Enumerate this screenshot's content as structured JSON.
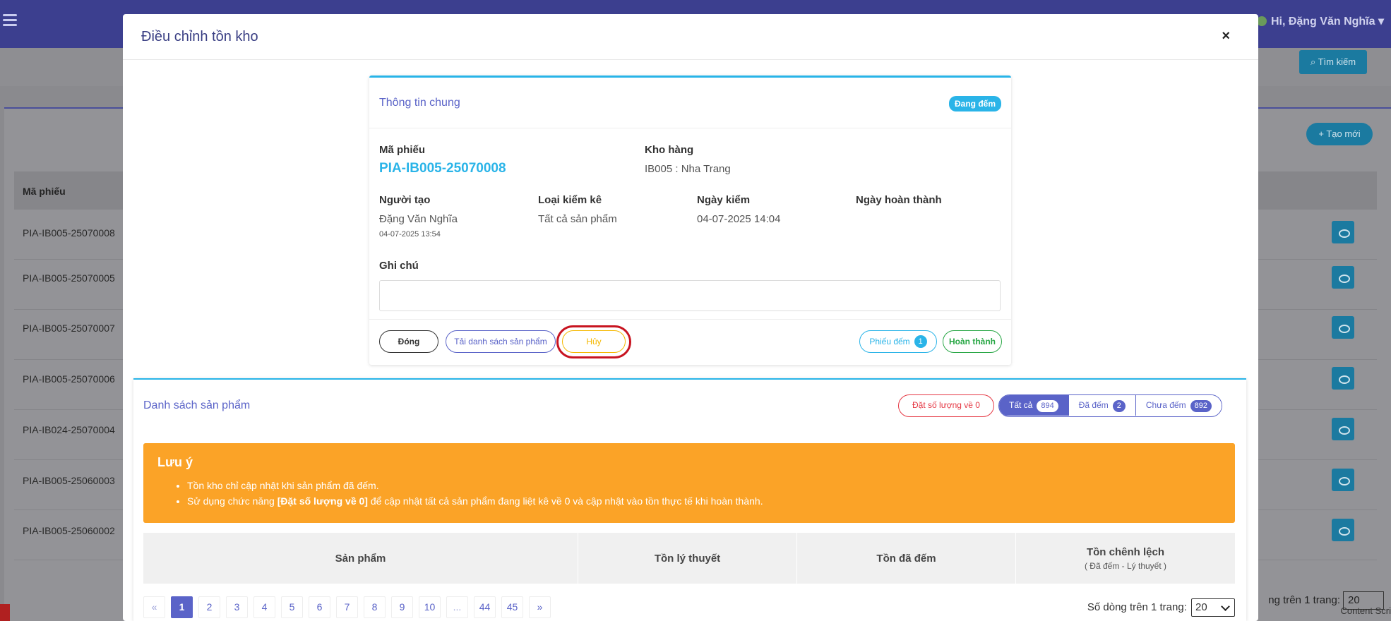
{
  "background": {
    "user_greeting": "Hi, Đặng Văn Nghĩa",
    "search_button": "Tìm kiếm",
    "create_button": "Tạo mới",
    "table_header": "Mã phiếu",
    "rows": [
      "PIA-IB005-25070008",
      "PIA-IB005-25070005",
      "PIA-IB005-25070007",
      "PIA-IB005-25070006",
      "PIA-IB024-25070004",
      "PIA-IB005-25060003",
      "PIA-IB005-25060002"
    ],
    "page_size_label": "ng trên 1 trang:",
    "page_size_value": "20",
    "content_label": "Content Scri"
  },
  "modal": {
    "title": "Điều chỉnh tồn kho",
    "close_symbol": "×"
  },
  "info": {
    "title": "Thông tin chung",
    "status": "Đang đếm",
    "code_label": "Mã phiếu",
    "code_value": "PIA-IB005-25070008",
    "warehouse_label": "Kho hàng",
    "warehouse_value": "IB005 : Nha Trang",
    "creator_label": "Người tạo",
    "creator_value": "Đặng Văn Nghĩa",
    "created_at": "04-07-2025 13:54",
    "type_label": "Loại kiểm kê",
    "type_value": "Tất cả sản phẩm",
    "count_date_label": "Ngày kiểm",
    "count_date_value": "04-07-2025 14:04",
    "done_date_label": "Ngày hoàn thành",
    "note_label": "Ghi chú",
    "note_value": ""
  },
  "actions": {
    "close": "Đóng",
    "download": "Tải danh sách sản phẩm",
    "cancel": "Hủy",
    "sheet": "Phiếu đếm",
    "sheet_count": "1",
    "complete": "Hoàn thành"
  },
  "list": {
    "title": "Danh sách sản phẩm",
    "zero_button": "Đặt số lượng về 0",
    "filters": [
      {
        "label": "Tất cả",
        "count": "894",
        "active": true
      },
      {
        "label": "Đã đếm",
        "count": "2",
        "active": false
      },
      {
        "label": "Chưa đếm",
        "count": "892",
        "active": false
      }
    ],
    "alert_title": "Lưu ý",
    "alert_line1": "Tồn kho chỉ cập nhật khi sản phẩm đã đếm.",
    "alert_line2_pre": "Sử dụng chức năng ",
    "alert_line2_bold": "[Đặt số lượng về 0]",
    "alert_line2_post": " để cập nhật tất cả sản phẩm đang liệt kê về 0 và cập nhật vào tồn thực tế khi hoàn thành.",
    "columns": [
      "Sản phẩm",
      "Tồn lý thuyết",
      "Tồn đã đếm",
      "Tồn chênh lệch"
    ],
    "diff_sub": "( Đã đếm - Lý thuyết )"
  },
  "pagination": {
    "prev": "«",
    "pages": [
      "1",
      "2",
      "3",
      "4",
      "5",
      "6",
      "7",
      "8",
      "9",
      "10",
      "...",
      "44",
      "45"
    ],
    "next": "»",
    "active": "1",
    "rows_label": "Số dòng trên 1 trang:",
    "rows_value": "20"
  },
  "colors": {
    "accent": "#5a63c8",
    "info": "#2ab4e8",
    "warning": "#fba327",
    "danger": "#e53945",
    "success": "#28a745",
    "highlight_ring": "#c81420"
  }
}
